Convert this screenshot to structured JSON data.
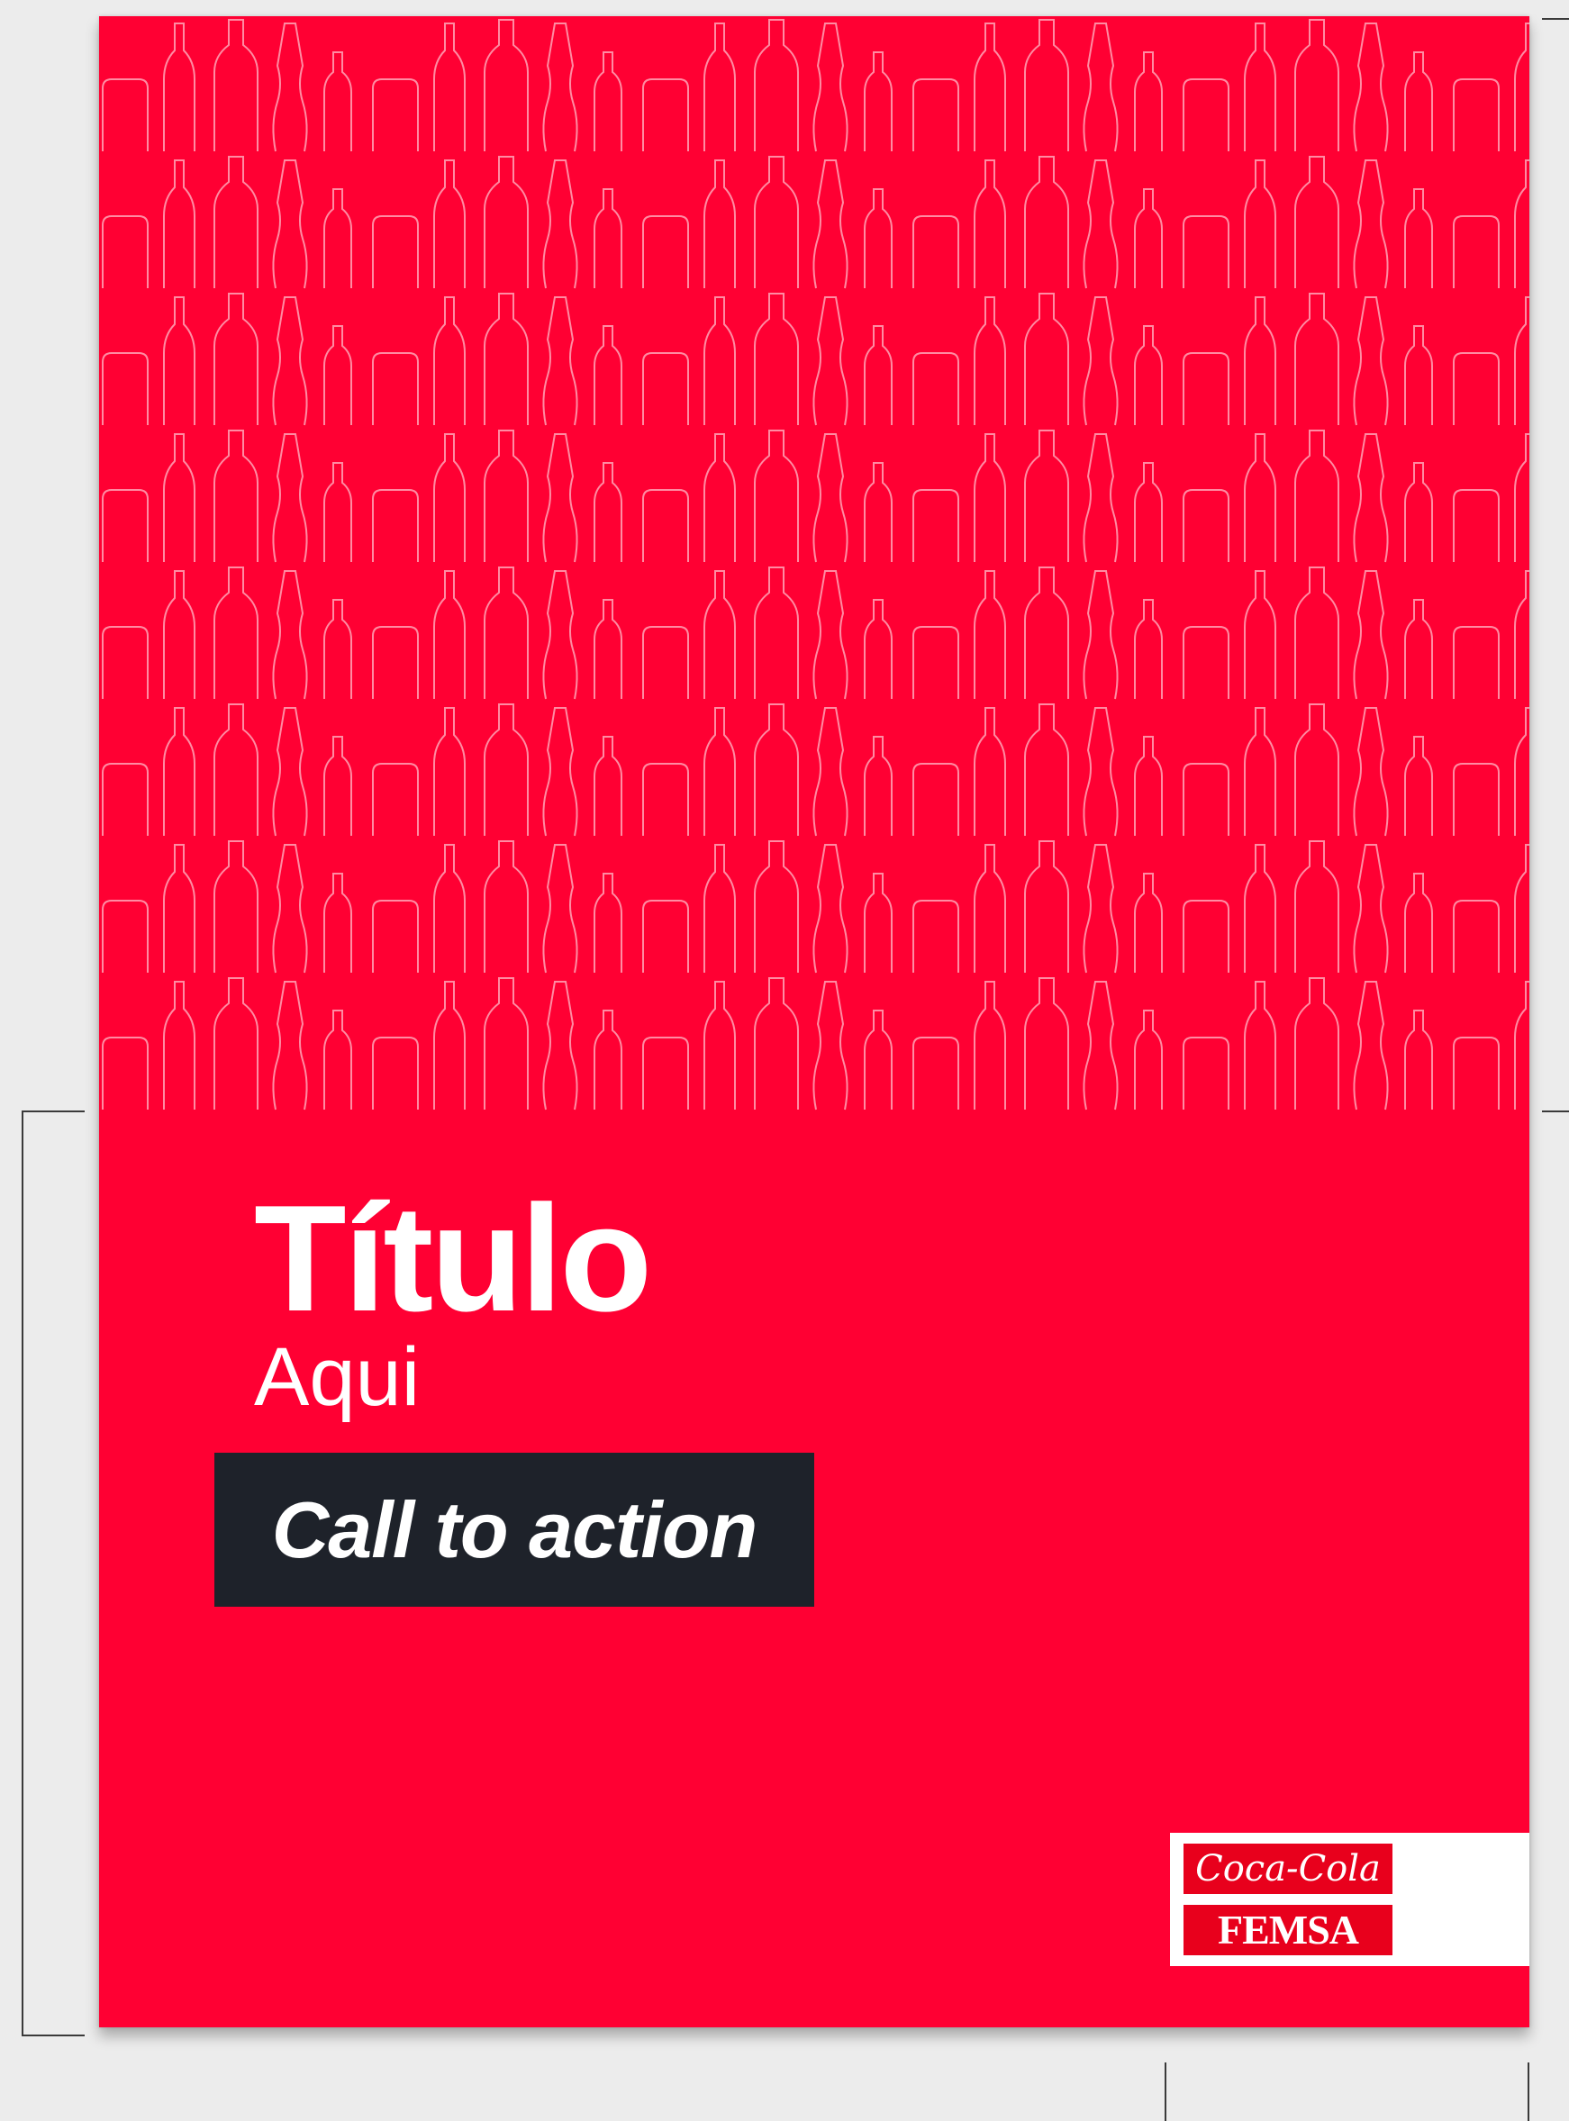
{
  "poster": {
    "title": "Título",
    "subtitle": "Aqui",
    "cta_label": "Call to action",
    "background_color": "#ff0033",
    "cta_background": "#1e222a"
  },
  "logo": {
    "brand_top": "Coca-Cola",
    "brand_bottom": "FEMSA",
    "color": "#e8001c"
  },
  "pattern": {
    "motif": "bottle-outline-icon",
    "stroke_color": "#ffffff"
  }
}
